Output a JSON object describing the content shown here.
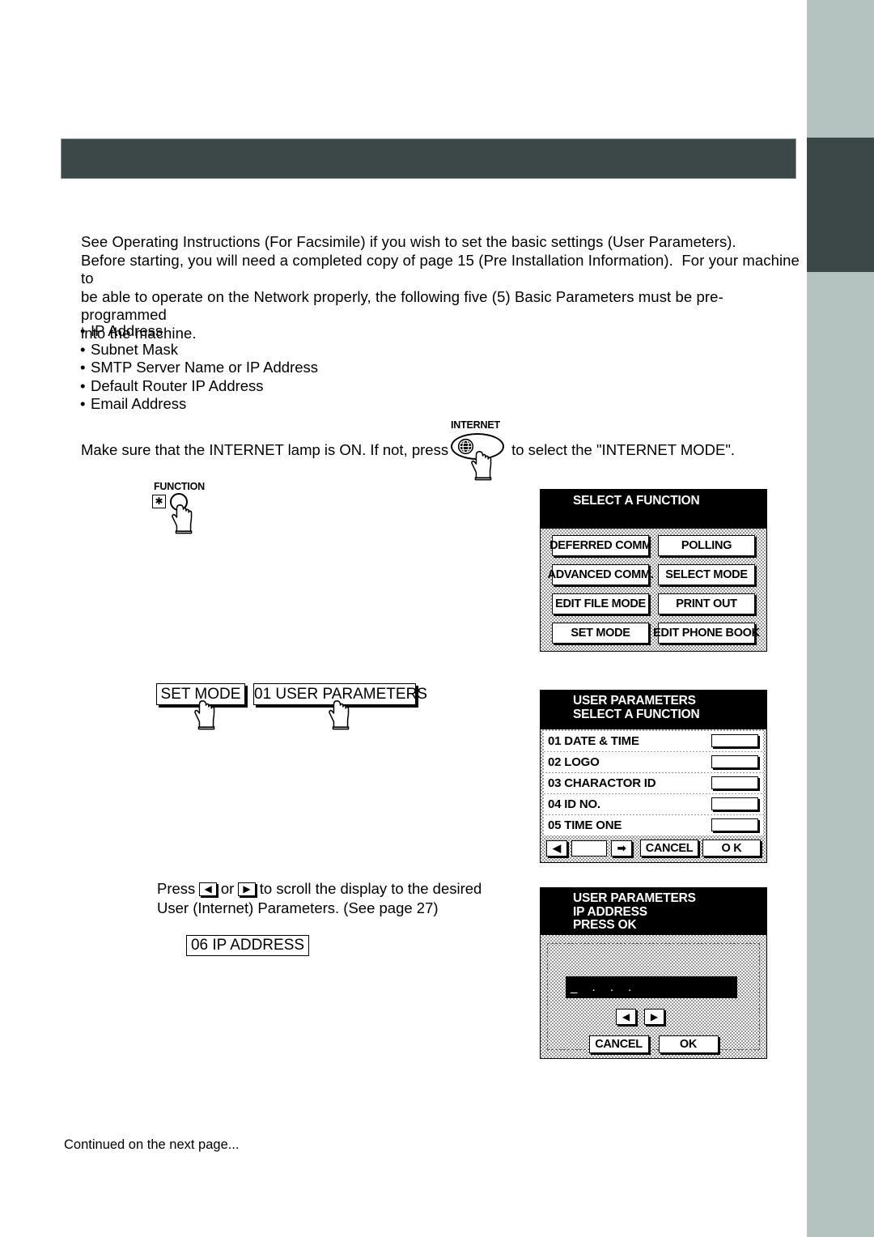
{
  "document": {
    "intro_paragraph": "See Operating Instructions (For Facsimile) if you wish to set the basic settings (User Parameters).\nBefore starting, you will need a completed copy of page 15 (Pre Installation Information).  For your machine to\nbe able to operate on the Network properly, the following five (5) Basic Parameters must be pre-programmed\ninto the machine.",
    "bullets": [
      "IP Address",
      "Subnet Mask",
      "SMTP Server Name or IP Address",
      "Default Router IP Address",
      "Email Address"
    ],
    "internet_line": {
      "before": "Make sure that the INTERNET lamp is ON.  If not, press",
      "after": "to select the \"INTERNET MODE\"."
    },
    "press_scroll": {
      "before": "Press",
      "left_key": "◀",
      "middle": "or",
      "right_key": "▶",
      "after": "to scroll the display to the desired",
      "line2": "User (Internet) Parameters.  (See page 27)"
    },
    "footer": "Continued on the next page..."
  },
  "keys": {
    "internet_label": "INTERNET",
    "function_label": "FUNCTION",
    "function_star": "✱"
  },
  "paper_buttons": {
    "set_mode": "SET MODE",
    "user_parameters": "01  USER PARAMETERS",
    "ip_address": "06 IP ADDRESS"
  },
  "lcd_function": {
    "title": "SELECT A FUNCTION",
    "buttons": [
      "DEFERRED COMM",
      "POLLING",
      "ADVANCED COMM.",
      "SELECT MODE",
      "EDIT FILE MODE",
      "PRINT OUT",
      "SET MODE",
      "EDIT PHONE BOOK"
    ]
  },
  "lcd_params": {
    "title_line1": "USER PARAMETERS",
    "title_line2": "SELECT A FUNCTION",
    "rows": [
      "01 DATE & TIME",
      "02 LOGO",
      "03 CHARACTOR ID",
      "04 ID NO.",
      "05 TIME   ONE"
    ],
    "prev_icon": "◀",
    "next_icon": "➡",
    "cancel": "CANCEL",
    "ok": "O K"
  },
  "lcd_ip": {
    "title_line1": "USER PARAMETERS",
    "title_line2": "IP ADDRESS",
    "title_line3": "PRESS OK",
    "field_value": "_ . . .",
    "left_arrow": "◀",
    "right_arrow": "▶",
    "cancel": "CANCEL",
    "ok": "OK"
  },
  "colors": {
    "header_band": "#3c4748",
    "side_rail": "#b4c3c0",
    "side_tab": "#3c4748"
  }
}
